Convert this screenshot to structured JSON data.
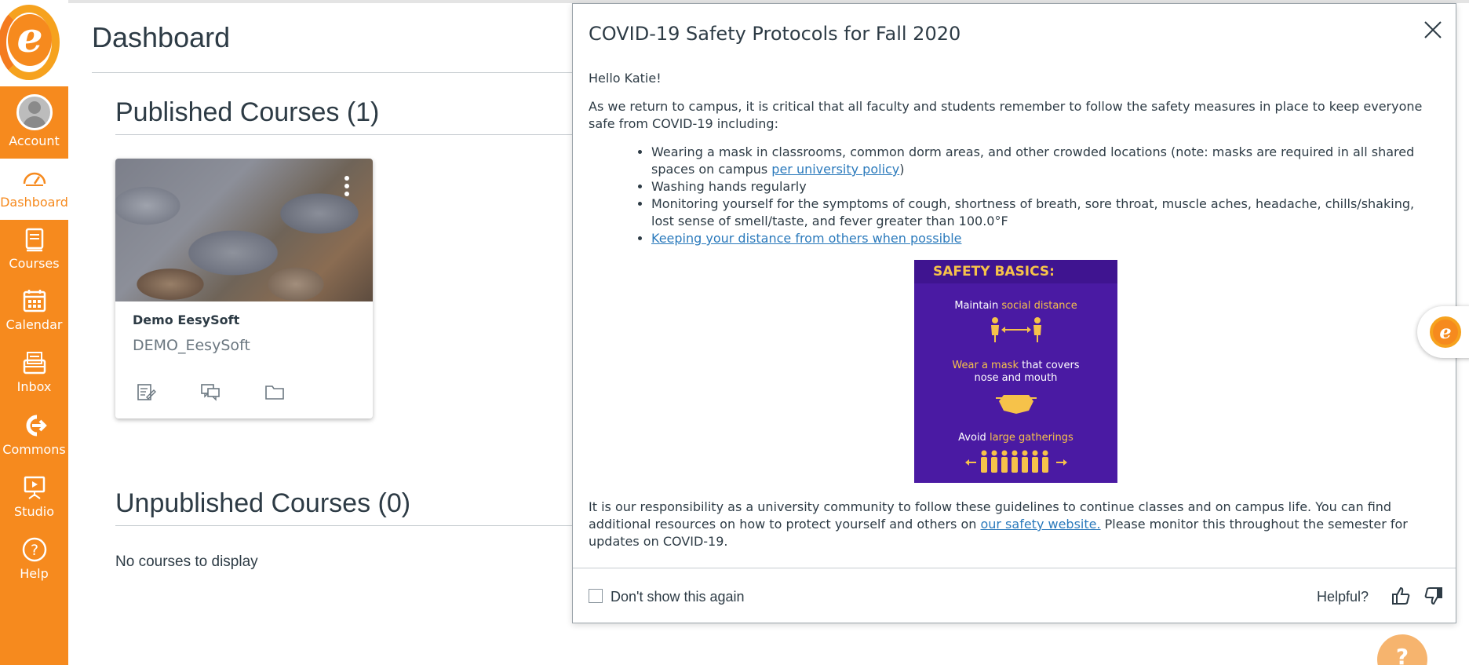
{
  "nav": {
    "account": "Account",
    "dashboard": "Dashboard",
    "courses": "Courses",
    "calendar": "Calendar",
    "inbox": "Inbox",
    "commons": "Commons",
    "studio": "Studio",
    "help": "Help",
    "brand_color": "#f68a1e"
  },
  "dashboard": {
    "title": "Dashboard",
    "published_heading": "Published Courses (1)",
    "unpublished_heading": "Unpublished Courses (0)",
    "no_courses": "No courses to display",
    "course_card": {
      "name": "Demo EesySoft",
      "code": "DEMO_EesySoft",
      "icons": [
        "assignments-icon",
        "discussions-icon",
        "files-icon"
      ]
    }
  },
  "modal": {
    "title": "COVID-19 Safety Protocols for Fall 2020",
    "greeting": "Hello Katie!",
    "intro": "As we return to campus, it is critical that all faculty and students remember to follow the safety measures in place to keep everyone safe from COVID-19 including:",
    "bullets": {
      "mask_text": "Wearing a mask in classrooms, common dorm areas, and other crowded locations (note: masks are required in all shared spaces on campus ",
      "mask_link": "per university policy",
      "mask_end": ")",
      "washing": "Washing hands regularly",
      "monitoring": "Monitoring yourself for the symptoms of cough, shortness of breath, sore throat, muscle aches, headache, chills/shaking, lost sense of smell/taste, and fever greater than 100.0°F",
      "distance_link": "Keeping your distance from others when possible"
    },
    "poster": {
      "heading": "SAFETY BASICS:",
      "line1_a": "Maintain ",
      "line1_b": "social distance",
      "line2_a": "Wear a mask",
      "line2_b": " that covers",
      "line2_c": "nose and mouth",
      "line3_a": "Avoid ",
      "line3_b": "large gatherings",
      "accent": "#f6c24a",
      "background": "#4a1aa3"
    },
    "closing_a": "It is our responsibility as a university community to follow these guidelines to continue classes and on campus life. You can find additional resources on how to protect yourself and others on ",
    "closing_link": "our safety website.",
    "closing_b": " Please monitor this throughout the semester for updates on COVID-19.",
    "dont_show": "Don't show this again",
    "helpful": "Helpful?"
  }
}
